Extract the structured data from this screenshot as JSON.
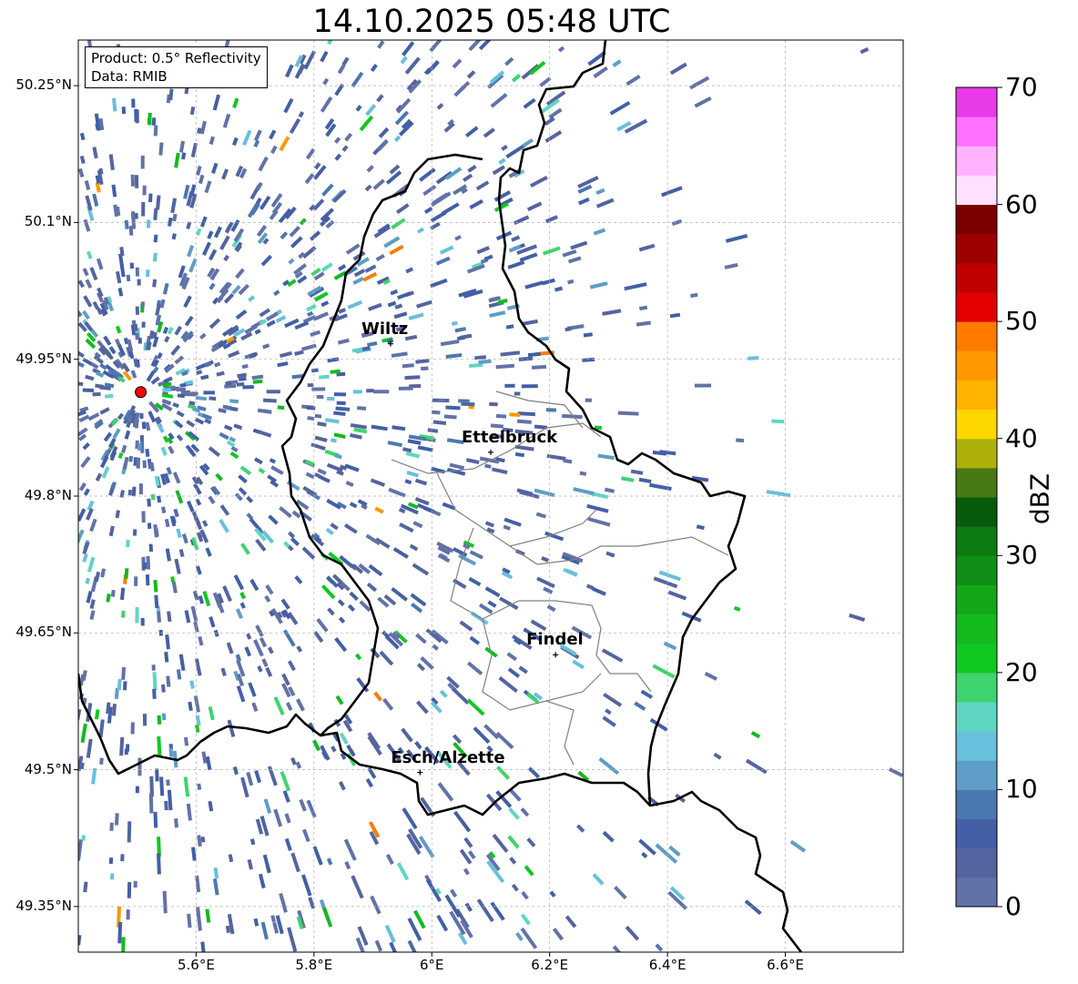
{
  "title": "14.10.2025 05:48 UTC",
  "info_box": {
    "product": "Product: 0.5° Reflectivity",
    "source": "Data: RMIB"
  },
  "lat_labels": [
    "50.25°N",
    "50.1°N",
    "49.95°N",
    "49.8°N",
    "49.65°N",
    "49.5°N",
    "49.35°N"
  ],
  "lon_labels": [
    "5.6°E",
    "5.8°E",
    "6°E",
    "6.2°E",
    "6.4°E",
    "6.6°E"
  ],
  "colorbar": {
    "label": "dBZ",
    "ticks": [
      "0",
      "10",
      "20",
      "30",
      "40",
      "50",
      "60",
      "70"
    ],
    "colors": [
      "#6272a8",
      "#5464a0",
      "#435fa6",
      "#4b78b0",
      "#5e9dc7",
      "#67c0dc",
      "#5fd6c2",
      "#3fd46d",
      "#10c820",
      "#12ba1e",
      "#14a818",
      "#0f8f15",
      "#0d7a12",
      "#075c0c",
      "#477a13",
      "#aeb00a",
      "#ffd700",
      "#fdb300",
      "#ff9800",
      "#ff7b00",
      "#e40000",
      "#c00000",
      "#9e0000",
      "#7a0000",
      "#ffe0ff",
      "#ffb3ff",
      "#ff72ff",
      "#e83ae8"
    ]
  },
  "cities": [
    {
      "name": "Wiltz",
      "lon": 5.93,
      "lat": 49.967
    },
    {
      "name": "Ettelbruck",
      "lon": 6.1,
      "lat": 49.848
    },
    {
      "name": "Findel",
      "lon": 6.21,
      "lat": 49.626
    },
    {
      "name": "Esch/Alzette",
      "lon": 5.98,
      "lat": 49.497
    }
  ],
  "radar_site": {
    "lon": 5.506,
    "lat": 49.914
  },
  "map_extent": {
    "lon_min": 5.4,
    "lon_max": 6.8,
    "lat_min": 49.3,
    "lat_max": 50.3
  },
  "colors": {
    "border": "#000000",
    "canton_lines": "#808080",
    "grid": "#b0b0b0",
    "radar_marker": "#ff0000"
  }
}
